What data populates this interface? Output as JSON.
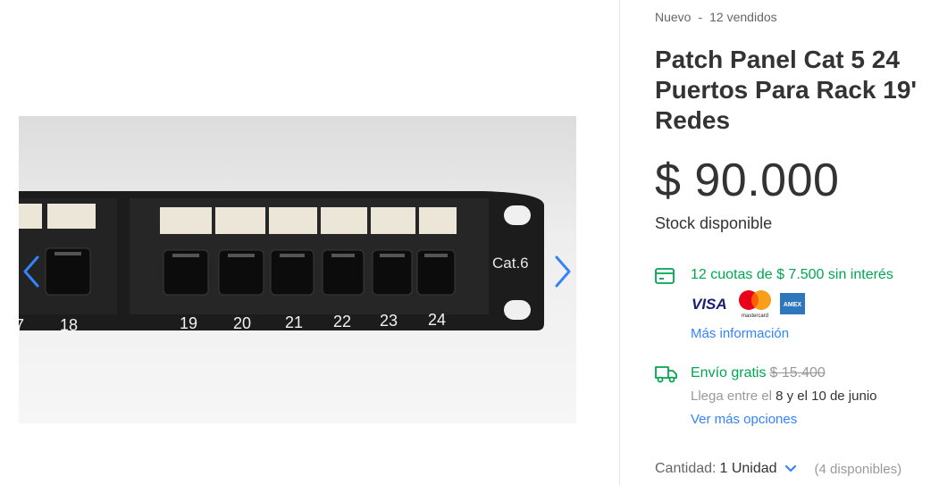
{
  "product": {
    "condition": "Nuevo",
    "separator": "-",
    "sold": "12 vendidos",
    "title": "Patch Panel Cat 5 24 Puertos Para Rack 19' Redes",
    "price": "$ 90.000",
    "stock": "Stock disponible"
  },
  "gallery": {
    "photo_label": "Cat.6",
    "port_numbers": [
      "7",
      "18",
      "19",
      "20",
      "21",
      "22",
      "23",
      "24"
    ],
    "prev_icon": "chevron-left-icon",
    "next_icon": "chevron-right-icon"
  },
  "payment": {
    "icon": "credit-card-icon",
    "installments": "12 cuotas de $ 7.500 sin interés",
    "cards": [
      "VISA",
      "mastercard",
      "AMEX"
    ],
    "more_info": "Más información"
  },
  "shipping": {
    "icon": "truck-icon",
    "label": "Envío gratis",
    "old_price": "$ 15.400",
    "arrival_prefix": "Llega entre el",
    "arrival_dates": "8 y el 10 de junio",
    "more_options": "Ver más opciones"
  },
  "quantity": {
    "label": "Cantidad:",
    "value": "1 Unidad",
    "available": "(4 disponibles)"
  },
  "colors": {
    "accent_blue": "#3483fa",
    "green": "#00a650"
  }
}
